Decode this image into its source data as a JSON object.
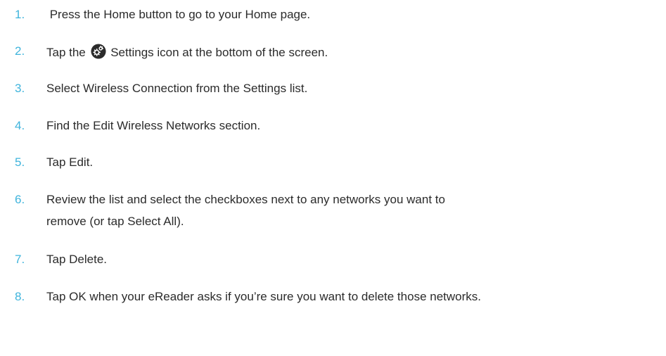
{
  "steps": [
    {
      "number": "1.",
      "text": " Press the Home button to go to your Home page."
    },
    {
      "number": "2.",
      "text_before": "Tap the ",
      "icon": "settings-gear-icon",
      "text_after": " Settings icon at the bottom of the screen."
    },
    {
      "number": "3.",
      "text": "Select Wireless Connection from the Settings list."
    },
    {
      "number": "4.",
      "text": "Find the Edit Wireless Networks section."
    },
    {
      "number": "5.",
      "text": "Tap Edit."
    },
    {
      "number": "6.",
      "text_line1": "Review the list and select the checkboxes next to any networks you want to",
      "text_line2": "remove (or tap Select All)."
    },
    {
      "number": "7.",
      "text": "Tap Delete."
    },
    {
      "number": "8.",
      "text": "Tap OK when your eReader asks if you’re sure you want to delete those networks."
    }
  ],
  "colors": {
    "number": "#3fb4dc",
    "text": "#2b2b2b"
  }
}
